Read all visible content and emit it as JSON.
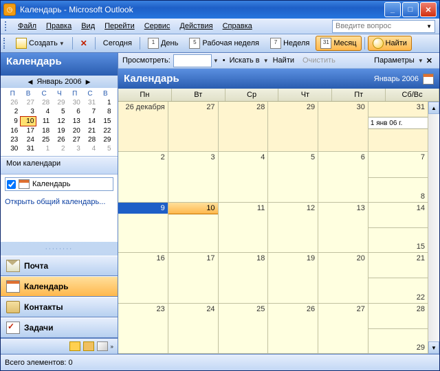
{
  "window": {
    "title": "Календарь - Microsoft Outlook"
  },
  "menu": {
    "file": "Файл",
    "edit": "Правка",
    "view": "Вид",
    "go": "Перейти",
    "tools": "Сервис",
    "actions": "Действия",
    "help": "Справка",
    "ask": "Введите вопрос"
  },
  "toolbar": {
    "create": "Создать",
    "today": "Сегодня",
    "day": "День",
    "workweek": "Рабочая неделя",
    "week": "Неделя",
    "month": "Месяц",
    "find": "Найти",
    "day_n": "1",
    "ww_n": "5",
    "wk_n": "7",
    "mo_n": "31"
  },
  "nav": {
    "header": "Календарь",
    "link": "Открыть общий календарь...",
    "mycals": "Мои календари",
    "calitem": "Календарь"
  },
  "datepicker": {
    "month": "Январь 2006",
    "dow": [
      "П",
      "В",
      "С",
      "Ч",
      "П",
      "С",
      "В"
    ],
    "rows": [
      [
        "26",
        "27",
        "28",
        "29",
        "30",
        "31",
        "1"
      ],
      [
        "2",
        "3",
        "4",
        "5",
        "6",
        "7",
        "8"
      ],
      [
        "9",
        "10",
        "11",
        "12",
        "13",
        "14",
        "15"
      ],
      [
        "16",
        "17",
        "18",
        "19",
        "20",
        "21",
        "22"
      ],
      [
        "23",
        "24",
        "25",
        "26",
        "27",
        "28",
        "29"
      ],
      [
        "30",
        "31",
        "1",
        "2",
        "3",
        "4",
        "5"
      ]
    ]
  },
  "navbtns": {
    "mail": "Почта",
    "calendar": "Календарь",
    "contacts": "Контакты",
    "tasks": "Задачи"
  },
  "findbar": {
    "view": "Просмотреть:",
    "searchin": "Искать в",
    "find": "Найти",
    "clear": "Очистить",
    "params": "Параметры"
  },
  "calview": {
    "title": "Календарь",
    "date": "Январь 2006",
    "dow": [
      "Пн",
      "Вт",
      "Ср",
      "Чт",
      "Пт",
      "Сб/Вс"
    ],
    "w1": [
      "26 декабря",
      "27",
      "28",
      "29",
      "30",
      "31",
      "1 янв 06 г."
    ],
    "w2": [
      "2",
      "3",
      "4",
      "5",
      "6",
      "7",
      "8"
    ],
    "w3": [
      "9",
      "10",
      "11",
      "12",
      "13",
      "14",
      "15"
    ],
    "w4": [
      "16",
      "17",
      "18",
      "19",
      "20",
      "21",
      "22"
    ],
    "w5": [
      "23",
      "24",
      "25",
      "26",
      "27",
      "28",
      "29"
    ]
  },
  "status": {
    "text": "Всего элементов: 0"
  }
}
